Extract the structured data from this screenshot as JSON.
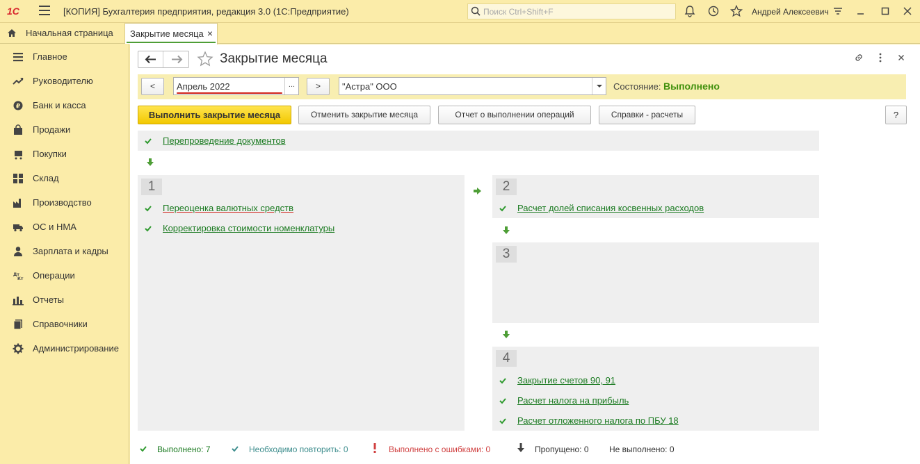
{
  "app": {
    "logo": "1С",
    "title": "[КОПИЯ] Бухгалтерия предприятия, редакция 3.0  (1С:Предприятие)",
    "search_placeholder": "Поиск Ctrl+Shift+F",
    "user": "Андрей Алексеевич"
  },
  "tabs": [
    {
      "label": "Начальная страница"
    },
    {
      "label": "Закрытие месяца",
      "close": "×"
    }
  ],
  "sidebar": {
    "items": [
      {
        "label": "Главное",
        "icon": "menu-lines-icon"
      },
      {
        "label": "Руководителю",
        "icon": "trend-icon"
      },
      {
        "label": "Банк и касса",
        "icon": "ruble-coin-icon"
      },
      {
        "label": "Продажи",
        "icon": "shopping-bag-icon"
      },
      {
        "label": "Покупки",
        "icon": "cart-icon"
      },
      {
        "label": "Склад",
        "icon": "warehouse-icon"
      },
      {
        "label": "Производство",
        "icon": "factory-icon"
      },
      {
        "label": "ОС и НМА",
        "icon": "truck-icon"
      },
      {
        "label": "Зарплата и кадры",
        "icon": "person-icon"
      },
      {
        "label": "Операции",
        "icon": "dt-kt-icon"
      },
      {
        "label": "Отчеты",
        "icon": "bar-chart-icon"
      },
      {
        "label": "Справочники",
        "icon": "book-icon"
      },
      {
        "label": "Администрирование",
        "icon": "gear-icon"
      }
    ]
  },
  "page": {
    "title": "Закрытие месяца",
    "prev_label": "<",
    "next_label": ">",
    "period": "Апрель 2022",
    "period_dots": "...",
    "organization": "\"Астра\" ООО",
    "state_label": "Состояние:",
    "state_value": "Выполнено",
    "state_color": "#40900c",
    "buttons": {
      "run": "Выполнить закрытие месяца",
      "cancel": "Отменить закрытие месяца",
      "report": "Отчет о выполнении операций",
      "refs": "Справки - расчеты",
      "help": "?"
    }
  },
  "operations": {
    "top": [
      "Перепроведение документов"
    ],
    "block1": {
      "num": "1",
      "items": [
        "Переоценка валютных средств",
        "Корректировка стоимости номенклатуры"
      ]
    },
    "block2": {
      "num": "2",
      "items": [
        "Расчет долей списания косвенных расходов"
      ]
    },
    "block3": {
      "num": "3",
      "items": []
    },
    "block4": {
      "num": "4",
      "items": [
        "Закрытие счетов 90, 91",
        "Расчет налога на прибыль",
        "Расчет отложенного налога по ПБУ 18"
      ]
    }
  },
  "status": {
    "done": {
      "label": "Выполнено:",
      "count": "7",
      "color": "#1a7a20"
    },
    "repeat": {
      "label": "Необходимо повторить:",
      "count": "0",
      "color": "#3d8d8d"
    },
    "errors": {
      "label": "Выполнено с ошибками:",
      "count": "0",
      "color": "#d04040"
    },
    "skipped": {
      "label": "Пропущено:",
      "count": "0",
      "color": "#333333"
    },
    "notdone": {
      "label": "Не выполнено:",
      "count": "0",
      "color": "#333333"
    }
  }
}
